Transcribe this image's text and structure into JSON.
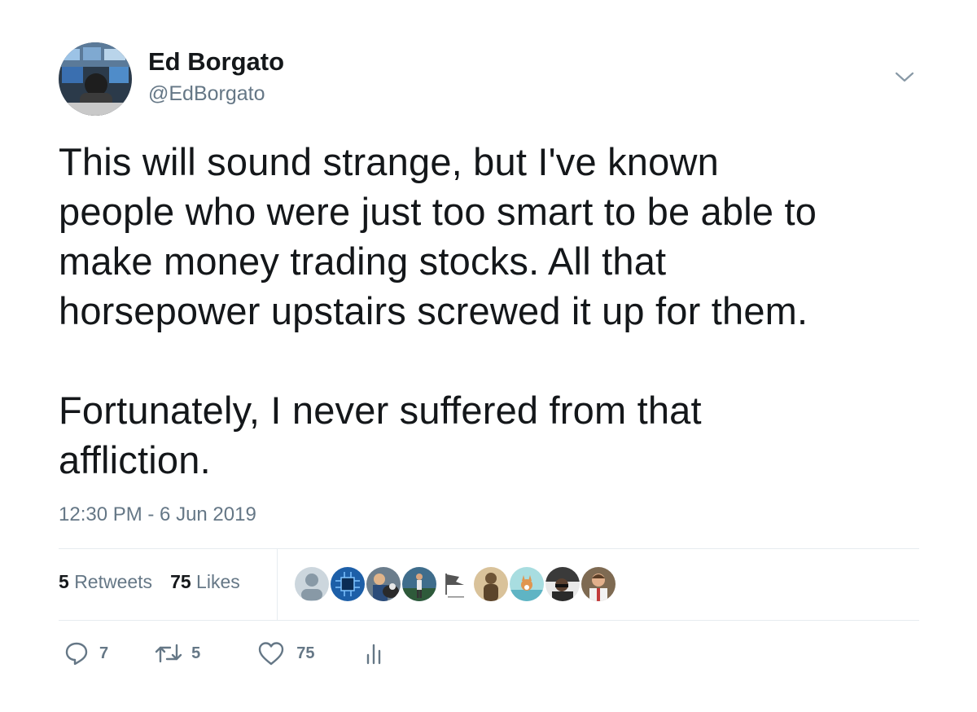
{
  "author": {
    "name": "Ed Borgato",
    "handle": "@EdBorgato"
  },
  "tweet": {
    "text": "This will sound strange, but I've known\npeople who were just too smart to be able to\nmake money trading stocks. All that\nhorsepower upstairs screwed it up for them.\n\nFortunately, I never suffered from that\naffliction.",
    "timestamp": "12:30 PM - 6 Jun 2019"
  },
  "stats": {
    "retweets_count": "5",
    "retweets_label": "Retweets",
    "likes_count": "75",
    "likes_label": "Likes"
  },
  "liker_avatars": [
    {
      "icon": "default-avatar-icon",
      "color": "#ccd6dd"
    },
    {
      "icon": "chip-avatar",
      "color": "#1d5fa8"
    },
    {
      "icon": "person-dog-avatar",
      "color": "#6b5a4a"
    },
    {
      "icon": "runner-avatar",
      "color": "#3f6d8c"
    },
    {
      "icon": "flag-avatar",
      "color": "#f5f5f5"
    },
    {
      "icon": "statue-avatar",
      "color": "#b08a55"
    },
    {
      "icon": "corgi-avatar",
      "color": "#a8dde0"
    },
    {
      "icon": "driver-avatar",
      "color": "#4a4a4a"
    },
    {
      "icon": "man-avatar",
      "color": "#8a6a55"
    }
  ],
  "actions": {
    "reply_count": "7",
    "retweet_count": "5",
    "like_count": "75"
  },
  "colors": {
    "text": "#14171a",
    "secondary": "#657786",
    "divider": "#e6ecf0"
  }
}
